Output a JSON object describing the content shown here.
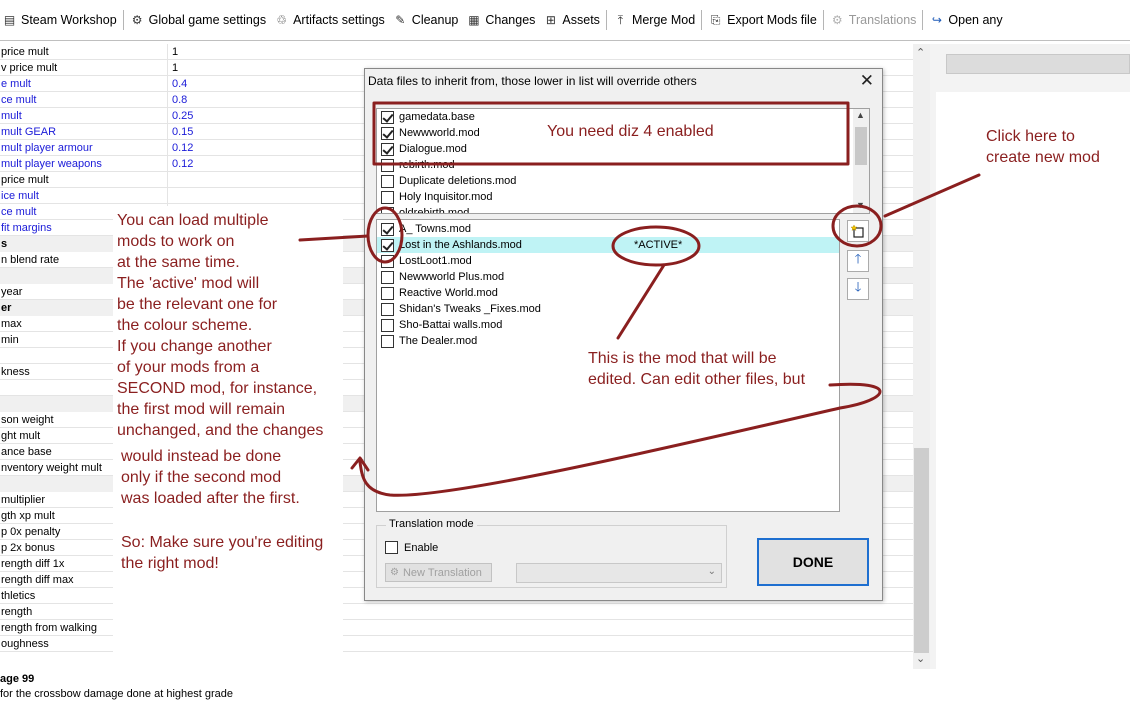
{
  "toolbar": {
    "items": [
      {
        "label": "Steam Workshop",
        "icon": "steam-icon"
      },
      {
        "label": "Global game settings",
        "icon": "gear-icon"
      },
      {
        "label": "Artifacts settings",
        "icon": "artifact-icon"
      },
      {
        "label": "Cleanup",
        "icon": "broom-icon"
      },
      {
        "label": "Changes",
        "icon": "changes-icon"
      },
      {
        "label": "Assets",
        "icon": "assets-icon"
      },
      {
        "label": "Merge Mod",
        "icon": "merge-icon"
      },
      {
        "label": "Export Mods file",
        "icon": "export-icon"
      },
      {
        "label": "Translations",
        "icon": "translations-icon",
        "disabled": true
      },
      {
        "label": "Open any",
        "icon": "open-icon"
      }
    ]
  },
  "grid": {
    "rows": [
      {
        "k": "price mult",
        "v": "1"
      },
      {
        "k": "v price mult",
        "v": "1"
      },
      {
        "k": "e mult",
        "v": "0.4",
        "blue": true
      },
      {
        "k": "ce mult",
        "v": "0.8",
        "blue": true
      },
      {
        "k": "mult",
        "v": "0.25",
        "blue": true
      },
      {
        "k": "mult GEAR",
        "v": "0.15",
        "blue": true
      },
      {
        "k": "mult player armour",
        "v": "0.12",
        "blue": true
      },
      {
        "k": "mult player weapons",
        "v": "0.12",
        "blue": true
      },
      {
        "k": "price mult",
        "v": ""
      },
      {
        "k": "ice mult",
        "v": "",
        "blue": true
      },
      {
        "k": "ce mult",
        "v": "",
        "blue": true
      },
      {
        "k": "fit margins",
        "v": "",
        "blue": true
      },
      {
        "k": "s",
        "v": "",
        "cat": true
      },
      {
        "k": "n blend rate",
        "v": ""
      },
      {
        "k": "",
        "v": "",
        "cat": true
      },
      {
        "k": "year",
        "v": ""
      },
      {
        "k": "er",
        "v": "",
        "cat": true
      },
      {
        "k": "max",
        "v": ""
      },
      {
        "k": "min",
        "v": ""
      },
      {
        "k": "",
        "v": ""
      },
      {
        "k": "kness",
        "v": ""
      },
      {
        "k": "",
        "v": ""
      },
      {
        "k": "",
        "v": "",
        "cat": true
      },
      {
        "k": "son weight",
        "v": ""
      },
      {
        "k": "ght mult",
        "v": ""
      },
      {
        "k": "ance base",
        "v": ""
      },
      {
        "k": "nventory weight mult",
        "v": ""
      },
      {
        "k": "",
        "v": "",
        "cat": true
      },
      {
        "k": "multiplier",
        "v": ""
      },
      {
        "k": "gth xp mult",
        "v": ""
      },
      {
        "k": "p 0x penalty",
        "v": ""
      },
      {
        "k": "p 2x bonus",
        "v": ""
      },
      {
        "k": "rength diff 1x",
        "v": ""
      },
      {
        "k": "rength diff max",
        "v": ""
      },
      {
        "k": "thletics",
        "v": ""
      },
      {
        "k": "rength",
        "v": ""
      },
      {
        "k": "rength from walking",
        "v": ""
      },
      {
        "k": "oughness",
        "v": ""
      }
    ],
    "bottom_label": "age 99",
    "bottom_desc": " for the crossbow damage done at highest grade"
  },
  "dialog": {
    "title": "Data files to inherit from, those lower in list will override others",
    "close_glyph": "✕",
    "inherit_items": [
      {
        "label": "gamedata.base",
        "checked": true
      },
      {
        "label": "Newwworld.mod",
        "checked": true
      },
      {
        "label": "Dialogue.mod",
        "checked": true
      },
      {
        "label": "rebirth.mod",
        "checked": false
      },
      {
        "label": "Duplicate deletions.mod",
        "checked": false
      },
      {
        "label": "Holy Inquisitor.mod",
        "checked": false
      },
      {
        "label": "oldrebirth.mod",
        "checked": false
      }
    ],
    "mod_items": [
      {
        "label": "A_ Towns.mod",
        "checked": true
      },
      {
        "label": "Lost in the Ashlands.mod",
        "checked": true,
        "active": true
      },
      {
        "label": "LostLoot1.mod",
        "checked": false
      },
      {
        "label": "Newwworld Plus.mod",
        "checked": false
      },
      {
        "label": "Reactive World.mod",
        "checked": false
      },
      {
        "label": "Shidan's Tweaks _Fixes.mod",
        "checked": false
      },
      {
        "label": "Sho-Battai walls.mod",
        "checked": false
      },
      {
        "label": "The Dealer.mod",
        "checked": false
      }
    ],
    "active_marker": "*ACTIVE*",
    "side_buttons": {
      "new_mod_icon": "new-mod-icon",
      "up_icon": "arrow-up-icon",
      "down_icon": "arrow-down-icon"
    },
    "translation": {
      "group_label": "Translation mode",
      "enable_label": "Enable",
      "new_translation_label": "New Translation"
    },
    "done_label": "DONE"
  },
  "annotations": {
    "need_enabled": "You need diz 4 enabled",
    "new_mod": "Click here to\ncreate new mod",
    "active_mod": "This is the mod that will be\nedited. Can edit other files, but",
    "multiple": "You can load multiple\nmods to work on\nat the same time.\nThe 'active' mod will\nbe the relevant one for\nthe colour scheme.\nIf you change another\nof your mods from a\nSECOND mod, for instance,\nthe first mod will remain\nunchanged, and the changes",
    "multiple2": "would instead be done\nonly if the second mod\nwas loaded after the first.",
    "so": "So: Make sure you're editing\nthe right mod!",
    "color": "#8a1f1f"
  }
}
